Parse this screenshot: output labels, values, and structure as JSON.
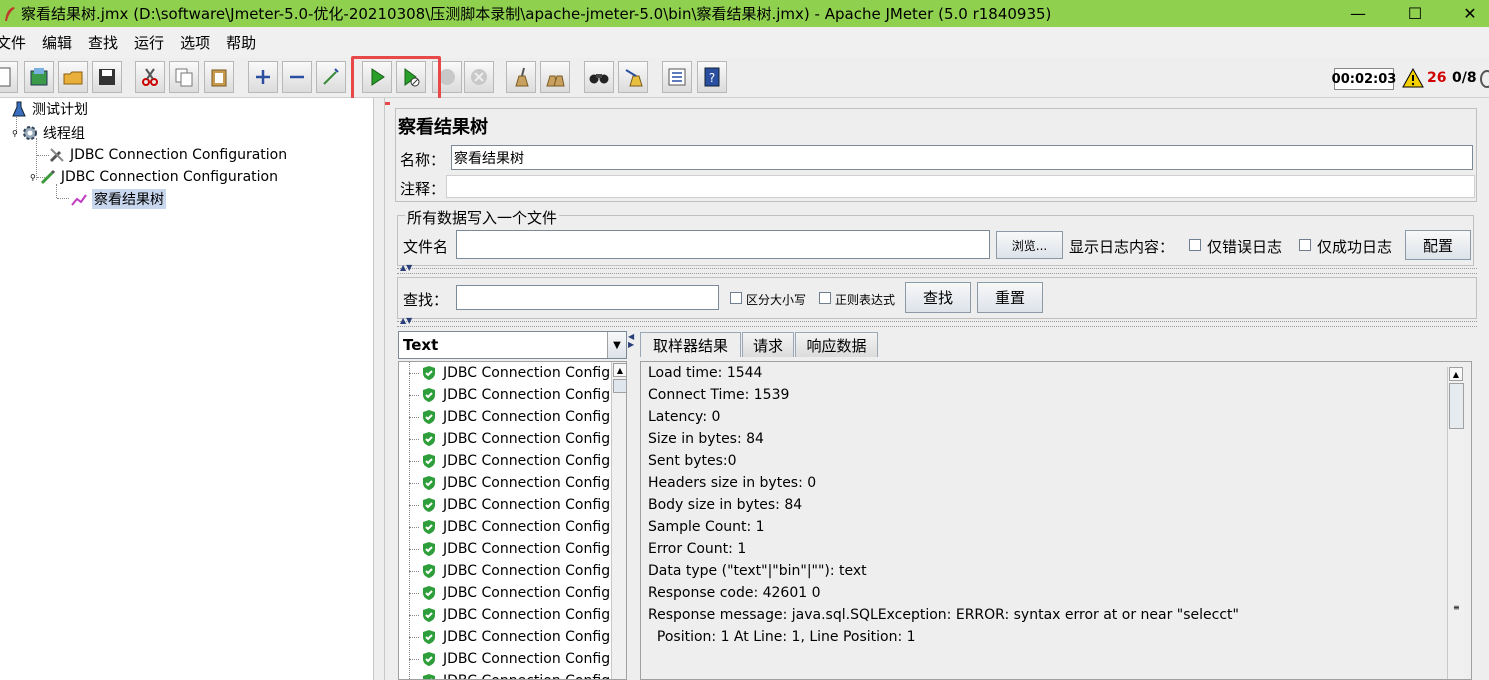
{
  "window": {
    "title": "察看结果树.jmx (D:\\software\\Jmeter-5.0-优化-20210308\\压测脚本录制\\apache-jmeter-5.0\\bin\\察看结果树.jmx) - Apache JMeter (5.0 r1840935)",
    "minimize": "—",
    "maximize": "☐",
    "close": "✕"
  },
  "menu": [
    "文件",
    "编辑",
    "查找",
    "运行",
    "选项",
    "帮助"
  ],
  "toolbar": {
    "timer": "00:02:03",
    "warning_count": "26",
    "threads": "0/8"
  },
  "tree": {
    "items": [
      {
        "label": "测试计划"
      },
      {
        "label": "线程组"
      },
      {
        "label": "JDBC Connection Configuration"
      },
      {
        "label": "JDBC Connection Configuration"
      },
      {
        "label": "察看结果树"
      }
    ]
  },
  "panel": {
    "title": "察看结果树",
    "name_label": "名称：",
    "name_value": "察看结果树",
    "comment_label": "注释：",
    "comment_value": "",
    "file_group_title": "所有数据写入一个文件",
    "filename_label": "文件名",
    "filename_value": "",
    "browse_button": "浏览...",
    "log_display_label": "显示日志内容：",
    "errors_only_label": "仅错误日志",
    "success_only_label": "仅成功日志",
    "configure_button": "配置",
    "search_label": "查找：",
    "search_value": "",
    "case_sensitive_label": "区分大小写",
    "regex_label": "正则表达式",
    "find_button": "查找",
    "reset_button": "重置"
  },
  "results": {
    "renderer": "Text",
    "item_label": "JDBC Connection Configu",
    "item_count": 15
  },
  "tabs": [
    "取样器结果",
    "请求",
    "响应数据"
  ],
  "detail_lines": [
    "Load time: 1544",
    "Connect Time: 1539",
    "Latency: 0",
    "Size in bytes: 84",
    "Sent bytes:0",
    "Headers size in bytes: 0",
    "Body size in bytes: 84",
    "Sample Count: 1",
    "Error Count: 1",
    "Data type (\"text\"|\"bin\"|\"\"): text",
    "Response code: 42601 0",
    "Response message: java.sql.SQLException: ERROR: syntax error at or near \"selecct\"",
    "  Position: 1 At Line: 1, Line Position: 1"
  ],
  "colors": {
    "titlebar": "#8fd14f",
    "highlight": "#e84848",
    "warning": "#d00000",
    "success_shield": "#2e9e3a"
  }
}
